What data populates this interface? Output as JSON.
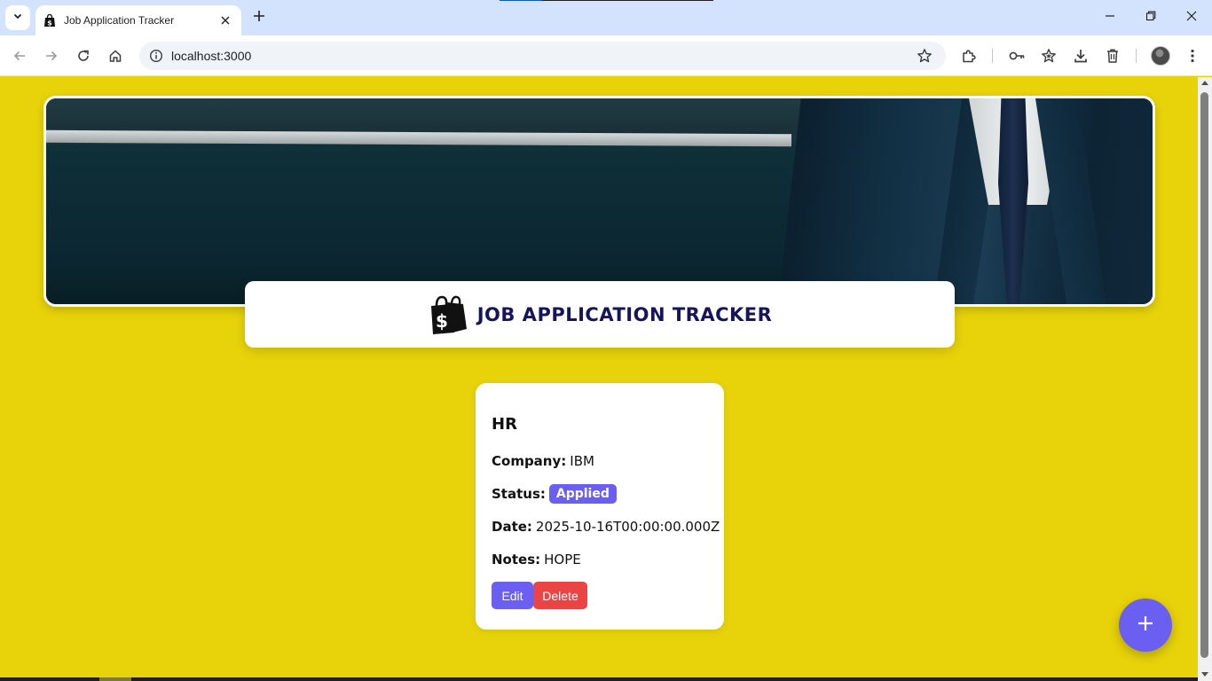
{
  "browser": {
    "tab": {
      "title": "Job Application Tracker",
      "favicon": "shopping-bag-dollar-icon"
    },
    "address_bar": {
      "url": "localhost:3000",
      "info_icon": "info-icon",
      "bookmark_icon": "star-icon"
    },
    "toolbar_icons": [
      "back-icon",
      "forward-icon",
      "reload-icon",
      "home-icon",
      "extensions-icon",
      "password-key-icon",
      "bookmarks-star-icon",
      "download-icon",
      "trash-icon",
      "profile-avatar",
      "menu-kebab-icon"
    ],
    "window_controls": [
      "minimize-icon",
      "restore-icon",
      "close-icon"
    ]
  },
  "app": {
    "title": "JOB APPLICATION TRACKER",
    "logo_icon": "shopping-bag-dollar-icon",
    "background_color": "#e8d30a",
    "accent_color": "#6a5ff0",
    "danger_color": "#ea4444",
    "title_color": "#16155c"
  },
  "jobs": [
    {
      "title": "HR",
      "company_label": "Company:",
      "company": "IBM",
      "status_label": "Status:",
      "status": "Applied",
      "date_label": "Date:",
      "date": "2025-10-16T00:00:00.000Z",
      "notes_label": "Notes:",
      "notes": "HOPE",
      "edit_label": "Edit",
      "delete_label": "Delete"
    }
  ],
  "fab": {
    "icon": "plus-icon"
  }
}
